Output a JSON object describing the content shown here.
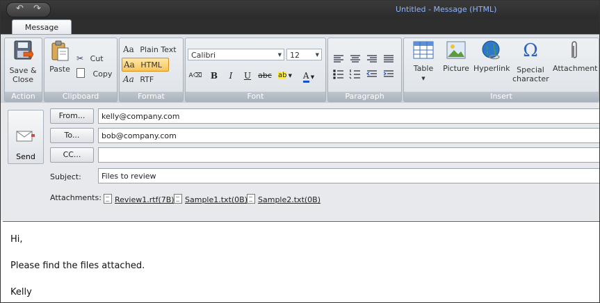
{
  "window": {
    "title": "Untitled - Message (HTML)"
  },
  "tabs": [
    {
      "label": "Message"
    }
  ],
  "ribbon": {
    "action": {
      "save_close": "Save &\nClose",
      "caption": "Action"
    },
    "clipboard": {
      "paste": "Paste",
      "cut": "Cut",
      "copy": "Copy",
      "caption": "Clipboard"
    },
    "format": {
      "plain_text": "Plain Text",
      "html": "HTML",
      "rtf": "RTF",
      "caption": "Format",
      "selected": "HTML"
    },
    "font": {
      "family": "Calibri",
      "size": "12",
      "caption": "Font"
    },
    "paragraph": {
      "caption": "Paragraph"
    },
    "insert": {
      "table": "Table",
      "picture": "Picture",
      "hyperlink": "Hyperlink",
      "special_character": "Special\ncharacter",
      "attachment": "Attachment",
      "caption": "Insert"
    }
  },
  "compose": {
    "send": "Send",
    "from_button": "From...",
    "from_value": "kelly@company.com",
    "to_button": "To...",
    "to_value": "bob@company.com",
    "cc_button": "CC...",
    "cc_value": "",
    "subject_label": "Subject:",
    "subject_value": "Files to review",
    "attachments_label": "Attachments:",
    "attachments": [
      "Review1.rtf(7B)",
      "Sample1.txt(0B)",
      "Sample2.txt(0B)"
    ]
  },
  "body": {
    "lines": [
      "Hi,",
      "Please find the files attached.",
      "Kelly"
    ]
  },
  "colors": {
    "title_text": "#8fb4ff",
    "highlight": "#f7c65a",
    "ribbon_caption": "#aab2bb"
  }
}
